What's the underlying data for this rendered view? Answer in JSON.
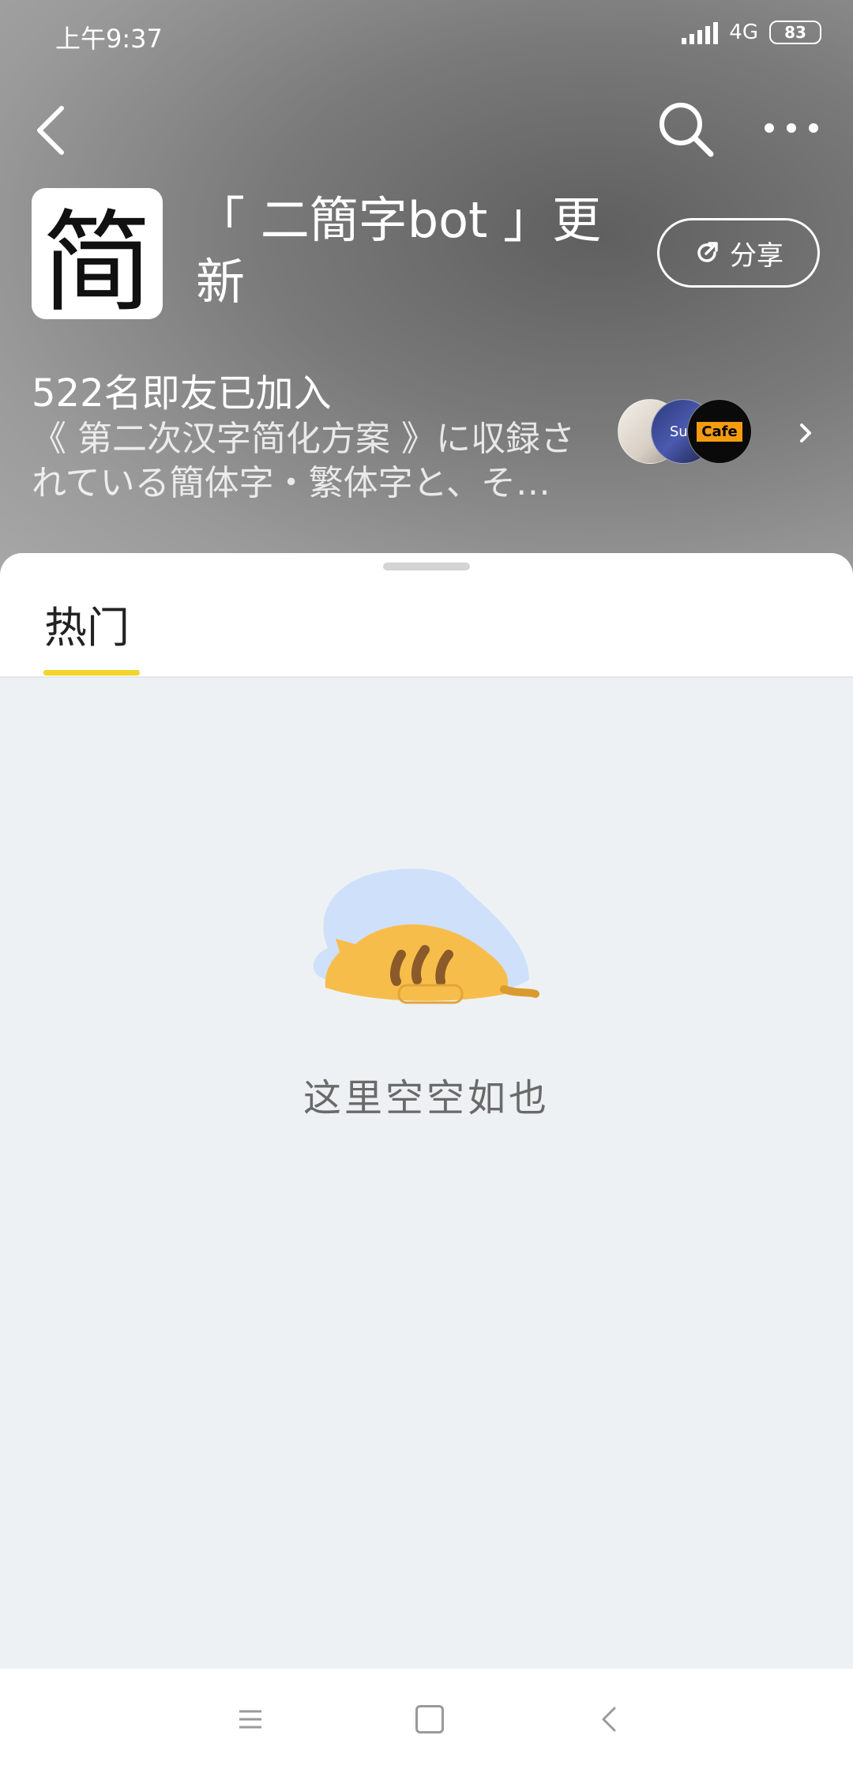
{
  "status_bar": {
    "time": "上午9:37",
    "network": "4G",
    "battery": "83"
  },
  "toolbar": {
    "back_icon": "back-arrow-icon",
    "search_icon": "search-icon",
    "more_icon": "more-dots-icon"
  },
  "group": {
    "avatar_char": "简",
    "title": "「 二簡字bot 」更新",
    "share_label": "分享",
    "share_icon": "share-icon",
    "members_count": "522名即友已加入",
    "description": "《 第二次汉字简化方案 》に収録されている簡体字・繁体字と、そ…",
    "member_avatars": [
      {
        "label": ""
      },
      {
        "label": "Sup"
      },
      {
        "label": "Cafe"
      }
    ]
  },
  "tabs": [
    {
      "label": "热门",
      "active": true
    }
  ],
  "empty_state": {
    "icon": "sleeping-cat-illustration",
    "text": "这里空空如也"
  },
  "nav_bar": {
    "menu_icon": "menu-icon",
    "home_icon": "home-square-icon",
    "back_icon": "nav-back-icon"
  },
  "colors": {
    "tab_indicator": "#f5d32b",
    "content_bg": "#eef1f4",
    "cat": "#f7bd4b"
  }
}
